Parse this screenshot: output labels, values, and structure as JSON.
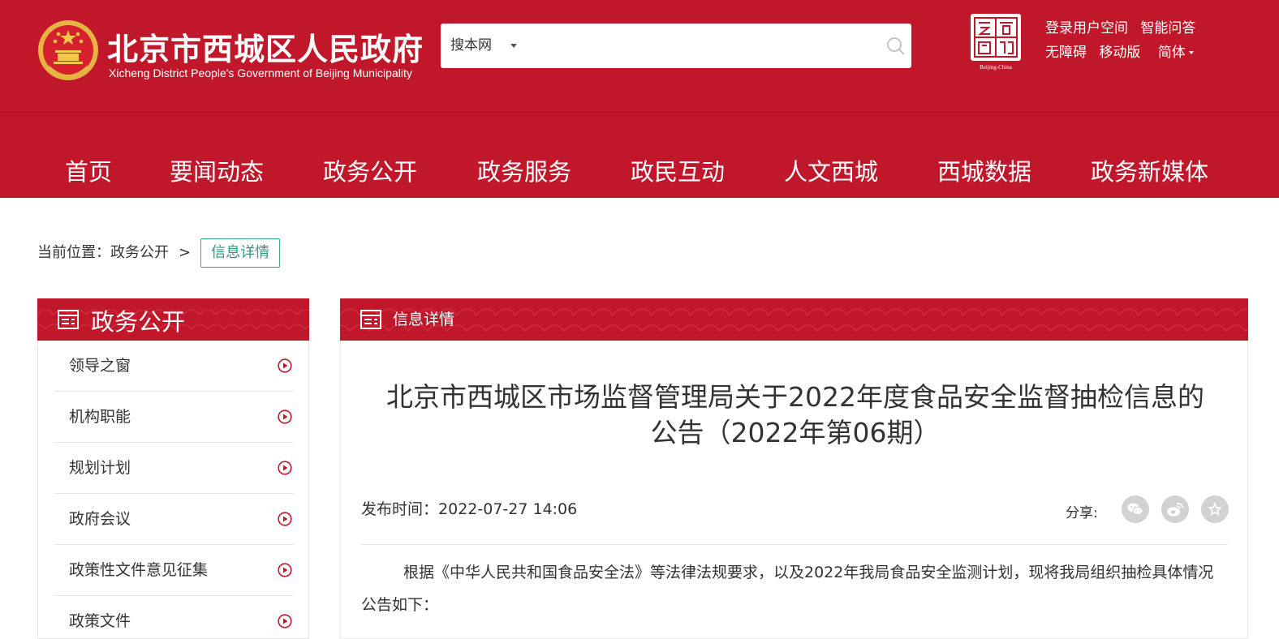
{
  "header": {
    "site_title": "北京市西城区人民政府",
    "site_subtitle": "Xicheng District People's Government of Beijing Municipality",
    "search": {
      "scope": "搜本网",
      "value": "",
      "placeholder": ""
    },
    "capital_logo_text": "Beijing-China",
    "top_links": {
      "login": "登录用户空间",
      "qa": "智能问答",
      "accessibility": "无障碍",
      "mobile": "移动版",
      "language": "简体"
    }
  },
  "nav": {
    "items": [
      "首页",
      "要闻动态",
      "政务公开",
      "政务服务",
      "政民互动",
      "人文西城",
      "西城数据",
      "政务新媒体"
    ]
  },
  "breadcrumb": {
    "label": "当前位置：",
    "parent": "政务公开",
    "separator": ">",
    "current": "信息详情"
  },
  "sidebar": {
    "title": "政务公开",
    "items": [
      "领导之窗",
      "机构职能",
      "规划计划",
      "政府会议",
      "政策性文件意见征集",
      "政策文件"
    ]
  },
  "main": {
    "section_title": "信息详情",
    "article_title_line1": "北京市西城区市场监督管理局关于2022年度食品安全监督抽检信息的",
    "article_title_line2": "公告（2022年第06期）",
    "pub_label": "发布时间：",
    "pub_time": "2022-07-27 14:06",
    "share_label": "分享:",
    "paragraph": "根据《中华人民共和国食品安全法》等法律法规要求，以及2022年我局食品安全监测计划，现将我局组织抽检具体情况公告如下："
  },
  "colors": {
    "brand_red": "#c0172b",
    "accent_green": "#2e9b7e",
    "share_grey": "#d2d2d2"
  },
  "icons": [
    "emblem-icon",
    "search-icon",
    "capital-window-logo",
    "list-icon",
    "circle-play-icon",
    "wechat-icon",
    "weibo-icon",
    "favorite-star-icon"
  ]
}
